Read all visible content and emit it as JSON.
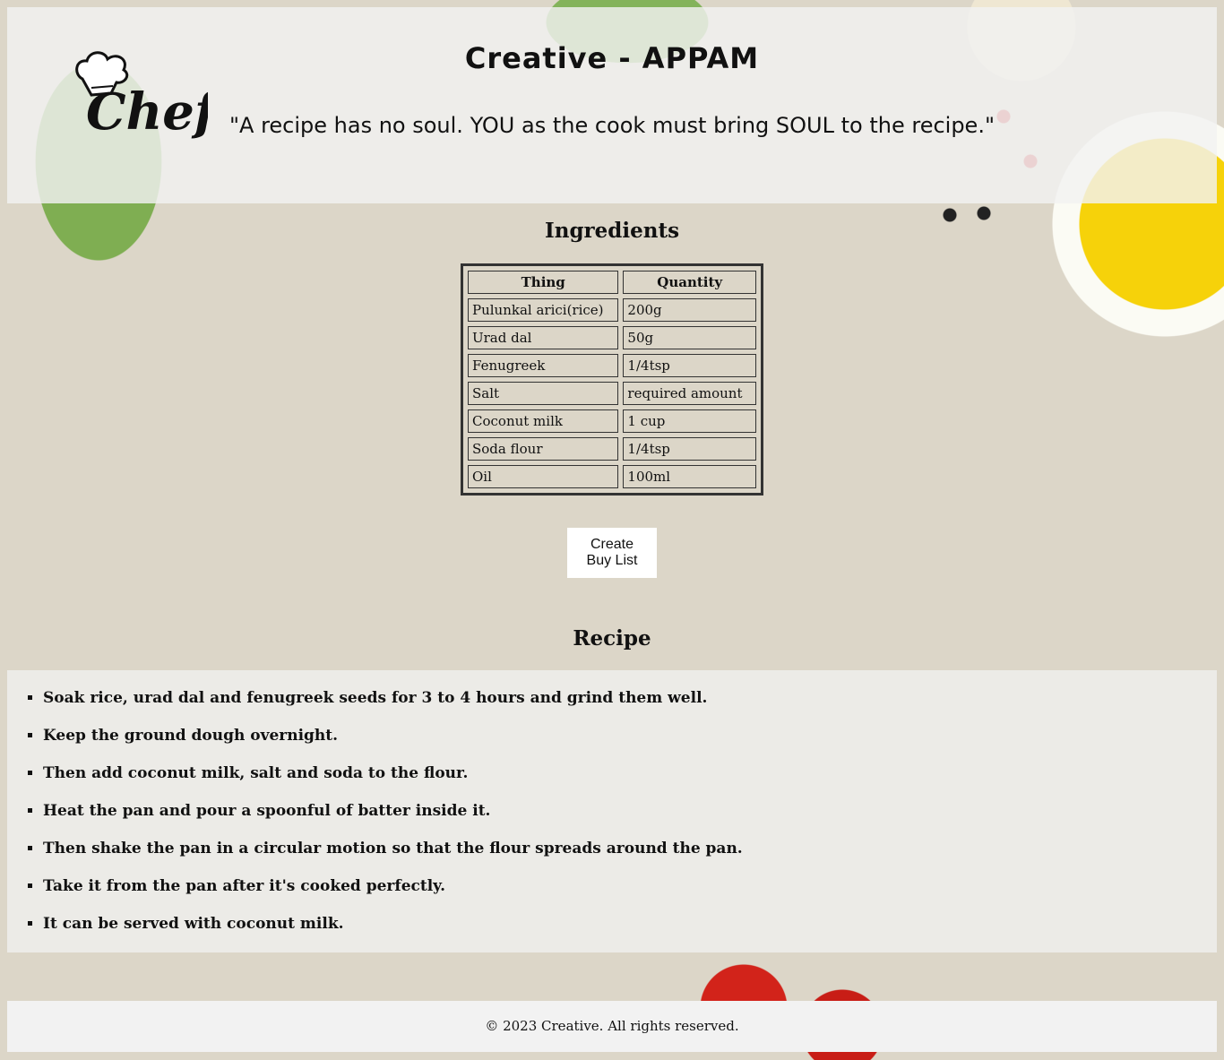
{
  "header": {
    "title": "Creative - APPAM",
    "quote": "\"A recipe has no soul. YOU as the cook must bring SOUL to the recipe.\"",
    "logo_text": "Chef"
  },
  "ingredients": {
    "heading": "Ingredients",
    "columns": [
      "Thing",
      "Quantity"
    ],
    "rows": [
      [
        "Pulunkal arici(rice)",
        "200g"
      ],
      [
        "Urad dal",
        "50g"
      ],
      [
        "Fenugreek",
        "1/4tsp"
      ],
      [
        "Salt",
        "required amount"
      ],
      [
        "Coconut milk",
        "1 cup"
      ],
      [
        "Soda flour",
        "1/4tsp"
      ],
      [
        "Oil",
        "100ml"
      ]
    ]
  },
  "buy_button": {
    "line1": "Create",
    "line2": "Buy List"
  },
  "recipe": {
    "heading": "Recipe",
    "steps": [
      "Soak rice, urad dal and fenugreek seeds for 3 to 4 hours and grind them well.",
      "Keep the ground dough overnight.",
      "Then add coconut milk, salt and soda to the flour.",
      "Heat the pan and pour a spoonful of batter inside it.",
      "Then shake the pan in a circular motion so that the flour spreads around the pan.",
      "Take it from the pan after it's cooked perfectly.",
      "It can be served with coconut milk."
    ]
  },
  "footer": {
    "text": "© 2023 Creative. All rights reserved."
  }
}
